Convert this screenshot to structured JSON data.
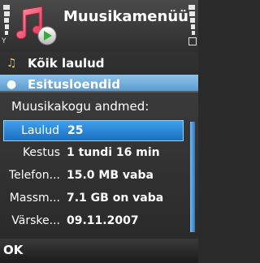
{
  "app": {
    "title": "Muusikamenüü"
  },
  "background_list": {
    "items": [
      {
        "label": "Kõik laulud",
        "icon": "music-notes-icon"
      },
      {
        "label": "Esitusloendid",
        "icon": "playlist-icon"
      }
    ]
  },
  "popup": {
    "title": "Muusikakogu andmed:",
    "rows": [
      {
        "key": "Laulud",
        "value": "25"
      },
      {
        "key": "Kestus",
        "value": "1 tundi 16 min"
      },
      {
        "key": "Telefon...",
        "value": "15.0 MB vaba"
      },
      {
        "key": "Massm...",
        "value": "7.1 GB on vaba"
      },
      {
        "key": "Värske...",
        "value": "09.11.2007"
      }
    ]
  },
  "softkeys": {
    "left": "OK"
  },
  "colors": {
    "selection": "#2a88d8",
    "popup_bg": "#2e2e2e",
    "text": "#ffffff"
  }
}
